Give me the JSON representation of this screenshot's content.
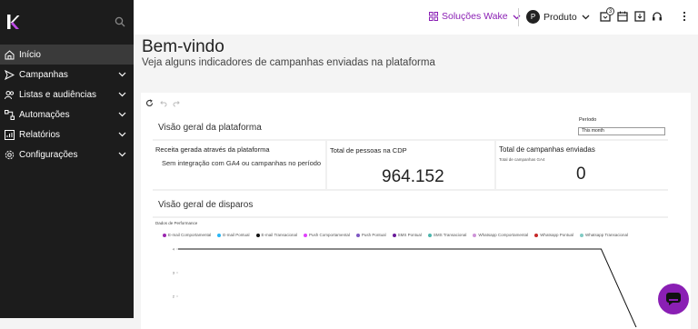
{
  "sidebar": {
    "items": [
      {
        "label": "Início",
        "icon": "home-icon",
        "active": true
      },
      {
        "label": "Campanhas",
        "icon": "send-icon"
      },
      {
        "label": "Listas e audiências",
        "icon": "users-icon"
      },
      {
        "label": "Automações",
        "icon": "flow-icon"
      },
      {
        "label": "Relatórios",
        "icon": "chart-icon"
      },
      {
        "label": "Configurações",
        "icon": "gear-icon"
      }
    ]
  },
  "topbar": {
    "workspace": "Soluções Wake",
    "product_initial": "P",
    "product": "Produto",
    "notification_count": "3"
  },
  "page": {
    "title": "Bem-vindo",
    "subtitle": "Veja alguns indicadores de campanhas enviadas na plataforma"
  },
  "dashboard": {
    "platform_section": "Visão geral da plataforma",
    "period_label": "Período",
    "period_value": "This month",
    "revenue_card": {
      "title": "Receita gerada através da plataforma",
      "message": "Sem integração com GA4 ou campanhas no período"
    },
    "people_card": {
      "title": "Total de pessoas na CDP",
      "value": "964.152"
    },
    "campaigns_card": {
      "title": "Total de campanhas enviadas",
      "caption": "Total de campanhas GA4",
      "value": "0"
    },
    "dispatch_section": "Visão geral de disparos",
    "chart_label": "Dados de Performance"
  },
  "colors": {
    "accent": "#8a1fb4"
  },
  "chart_data": {
    "type": "line",
    "title": "Dados de Performance",
    "y_ticks": [
      "4",
      "3",
      "2"
    ],
    "series": [
      {
        "name": "E-mail Comportamental",
        "color": "#9c27b0"
      },
      {
        "name": "E-mail Pontual",
        "color": "#29b6f6"
      },
      {
        "name": "E-mail Transacional",
        "color": "#111111"
      },
      {
        "name": "Push Comportamental",
        "color": "#e040fb"
      },
      {
        "name": "Push Pontual",
        "color": "#7e57c2"
      },
      {
        "name": "SMS Pontual",
        "color": "#6a1b9a"
      },
      {
        "name": "SMS Transacional",
        "color": "#4db6ac"
      },
      {
        "name": "Whatsapp Comportamental",
        "color": "#ce93d8"
      },
      {
        "name": "Whatsapp Pontual",
        "color": "#c62828"
      },
      {
        "name": "Whatsapp Transacional",
        "color": "#80cbc4"
      }
    ],
    "visible_line": {
      "series": "E-mail Transacional",
      "values": [
        4,
        4,
        4,
        4,
        4,
        4,
        4,
        4,
        4,
        4,
        4,
        0
      ]
    }
  }
}
